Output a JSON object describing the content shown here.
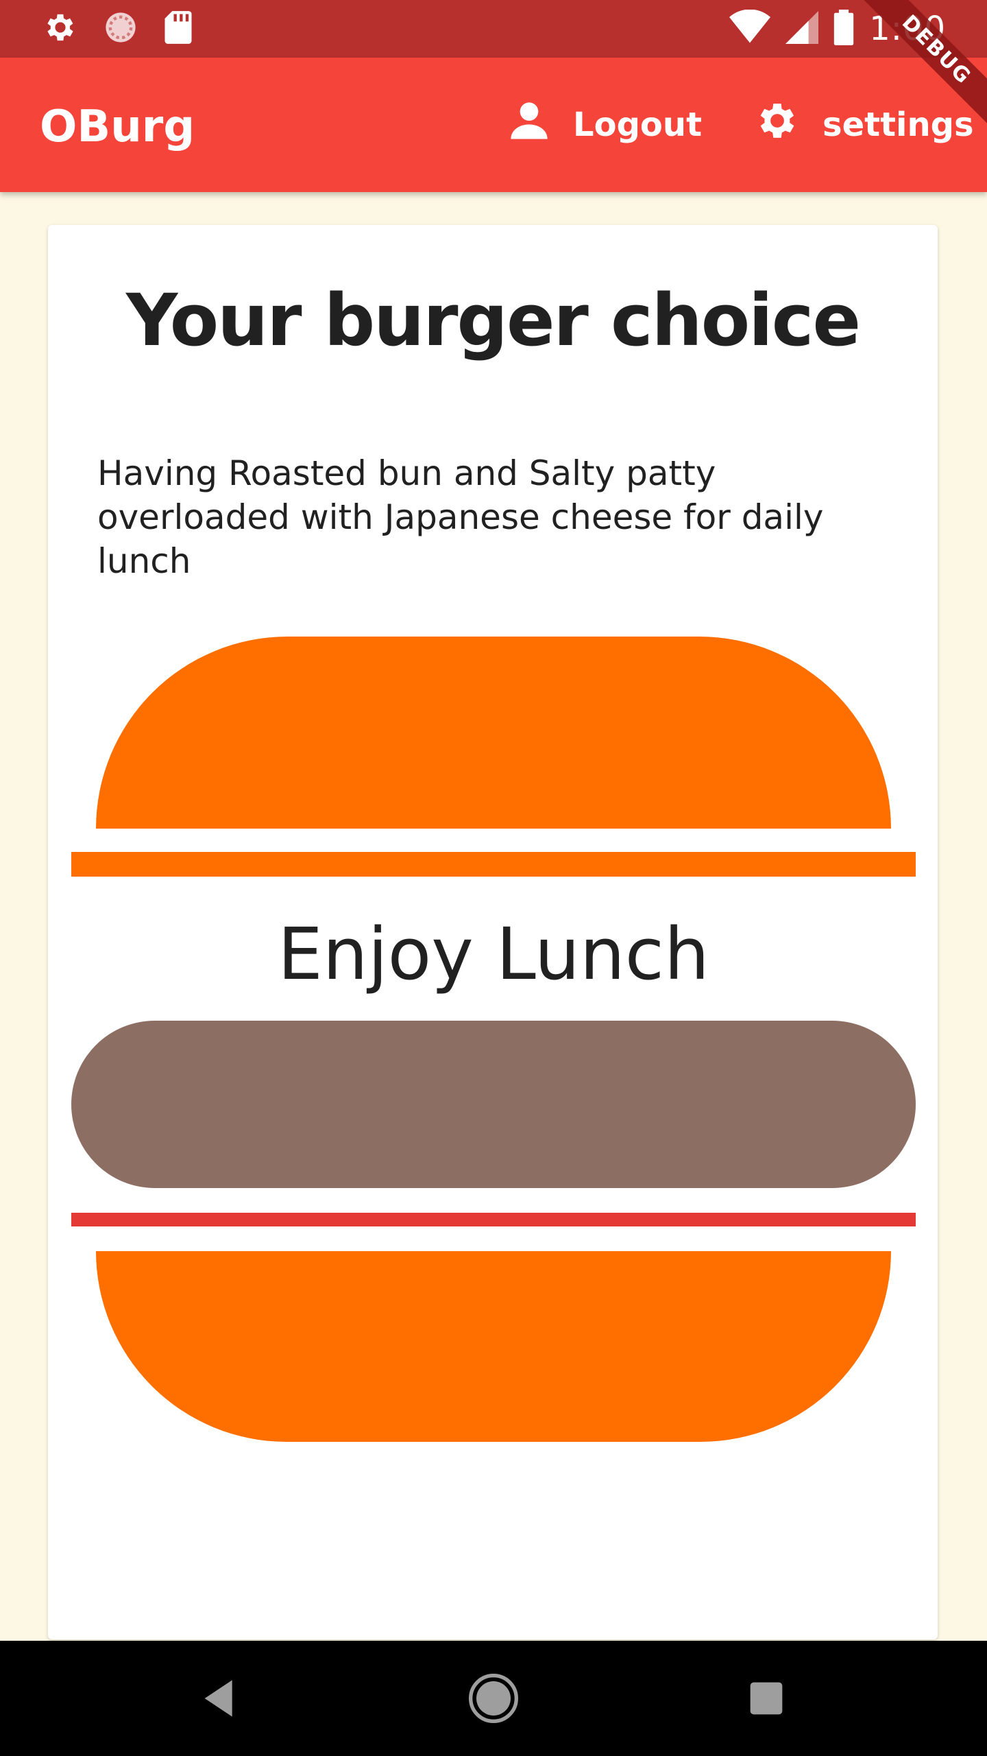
{
  "status_bar": {
    "time": "1:00",
    "icons": [
      "settings-icon",
      "sync-icon",
      "sd-card-icon",
      "wifi-icon",
      "signal-icon",
      "battery-icon"
    ],
    "background": "#b8302d"
  },
  "debug_banner": "DEBUG",
  "app_bar": {
    "title": "OBurg",
    "logout_label": "Logout",
    "settings_label": "settings",
    "background": "#f5443a"
  },
  "card": {
    "title": "Your burger choice",
    "description": "Having Roasted bun  and Salty patty overloaded with Japanese cheese for daily lunch",
    "center_text": "Enjoy Lunch"
  },
  "colors": {
    "bun": "#ff6f00",
    "patty": "#8d6e63",
    "sauce": "#e53935",
    "page_background": "#fdf8e4"
  },
  "nav_bar": {
    "buttons": [
      "back-icon",
      "home-icon",
      "recents-icon"
    ]
  }
}
